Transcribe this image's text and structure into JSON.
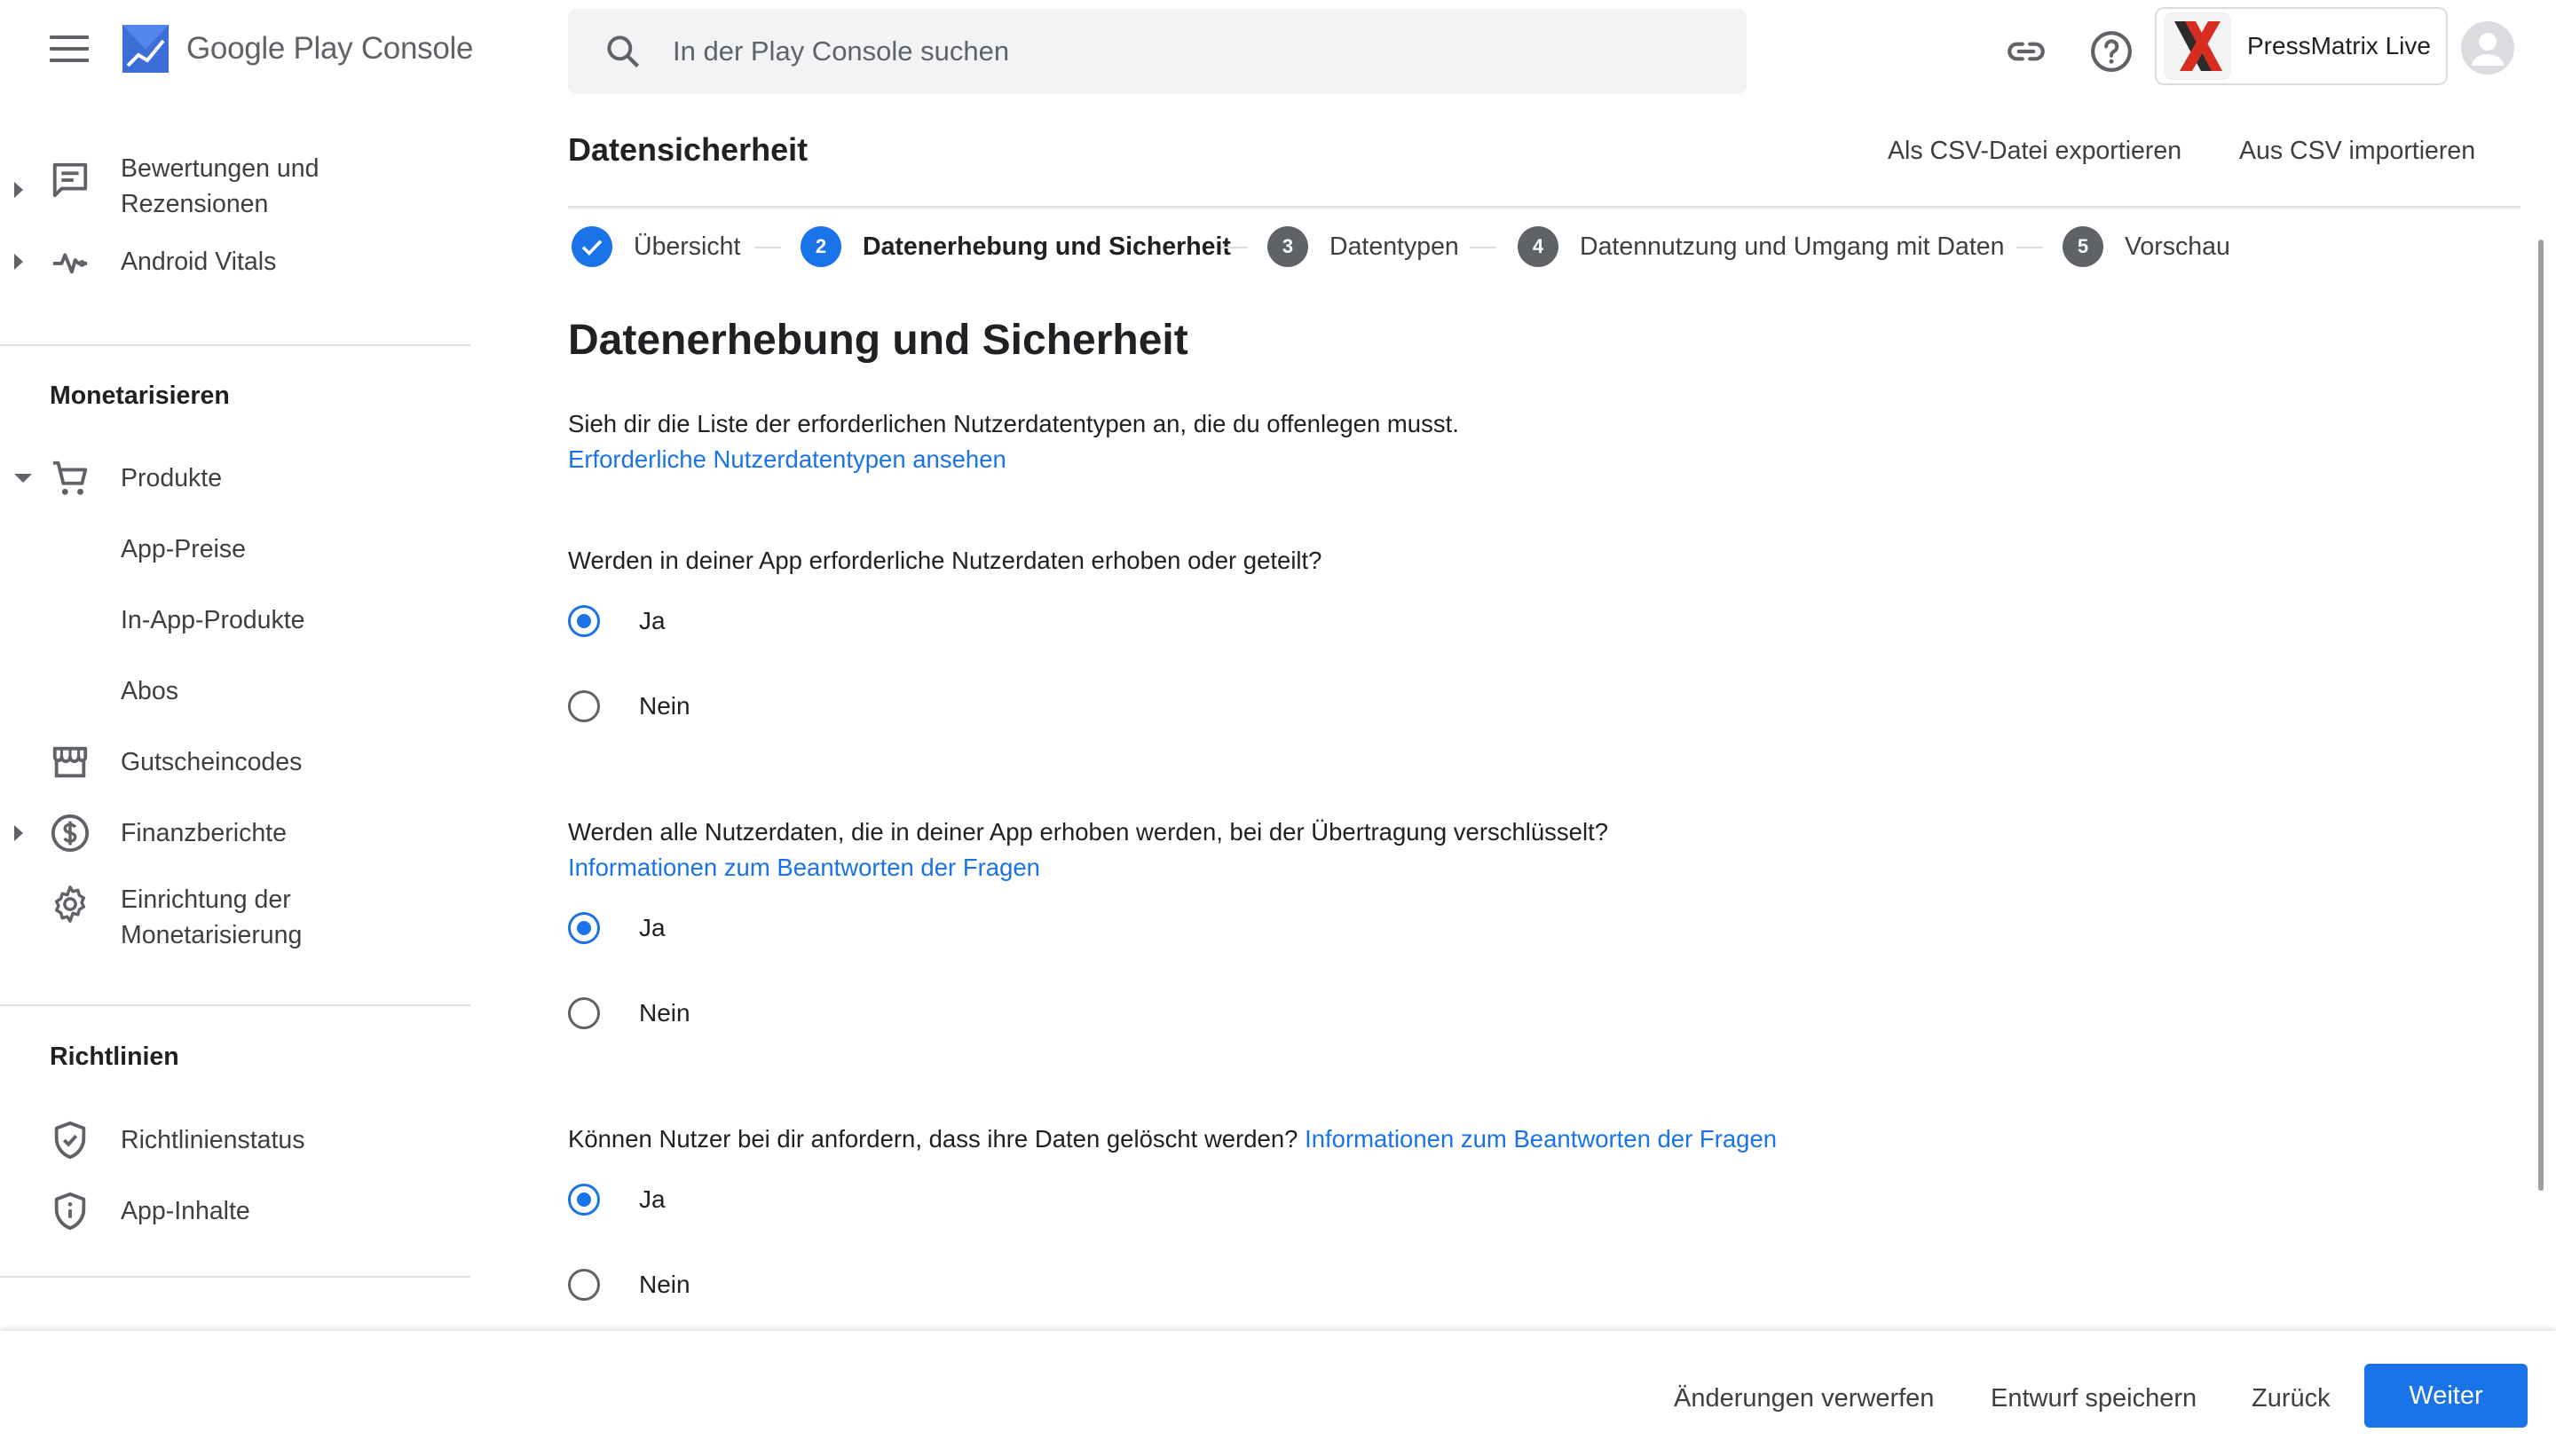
{
  "topbar": {
    "logo_word_1": "Google Play",
    "logo_word_2": "Console",
    "search_placeholder": "In der Play Console suchen",
    "app_name": "PressMatrix Live"
  },
  "sidebar": {
    "items_top": [
      {
        "line1": "Bewertungen und",
        "line2": "Rezensionen",
        "icon": "reviews-icon"
      },
      {
        "label": "Android Vitals",
        "icon": "vitals-icon"
      }
    ],
    "monetize_title": "Monetarisieren",
    "monetize_items": [
      {
        "label": "Produkte",
        "icon": "cart-icon"
      },
      {
        "label": "App-Preise"
      },
      {
        "label": "In-App-Produkte"
      },
      {
        "label": "Abos"
      },
      {
        "label": "Gutscheincodes",
        "icon": "store-icon"
      },
      {
        "label": "Finanzberichte",
        "icon": "dollar-icon"
      },
      {
        "line1": "Einrichtung der",
        "line2": "Monetarisierung",
        "icon": "settings-icon"
      }
    ],
    "policy_title": "Richtlinien",
    "policy_items": [
      {
        "label": "Richtlinienstatus",
        "icon": "shield-check-icon"
      },
      {
        "label": "App-Inhalte",
        "icon": "shield-info-icon"
      }
    ]
  },
  "header": {
    "title": "Datensicherheit",
    "export_csv": "Als CSV-Datei exportieren",
    "import_csv": "Aus CSV importieren"
  },
  "stepper": {
    "steps": [
      {
        "number": "",
        "label": "Übersicht",
        "state": "done"
      },
      {
        "number": "2",
        "label": "Datenerhebung und Sicherheit",
        "state": "current"
      },
      {
        "number": "3",
        "label": "Datentypen",
        "state": "pending"
      },
      {
        "number": "4",
        "label": "Datennutzung und Umgang mit Daten",
        "state": "pending"
      },
      {
        "number": "5",
        "label": "Vorschau",
        "state": "pending"
      }
    ]
  },
  "content": {
    "heading": "Datenerhebung und Sicherheit",
    "intro": "Sieh dir die Liste der erforderlichen Nutzerdatentypen an, die du offenlegen musst.",
    "intro_link": "Erforderliche Nutzerdatentypen ansehen",
    "q1": "Werden in deiner App erforderliche Nutzerdaten erhoben oder geteilt?",
    "q2": "Werden alle Nutzerdaten, die in deiner App erhoben werden, bei der Übertragung verschlüsselt?",
    "q2_link": "Informationen zum Beantworten der Fragen",
    "q3": "Können Nutzer bei dir anfordern, dass ihre Daten gelöscht werden?",
    "q3_link": "Informationen zum Beantworten der Fragen",
    "yes": "Ja",
    "no": "Nein",
    "answers": {
      "q1": "Ja",
      "q2": "Ja",
      "q3": "Ja"
    }
  },
  "footer": {
    "discard": "Änderungen verwerfen",
    "save_draft": "Entwurf speichern",
    "back": "Zurück",
    "next": "Weiter"
  },
  "colors": {
    "accent": "#1a73e8",
    "pending_step": "#5f6368"
  }
}
